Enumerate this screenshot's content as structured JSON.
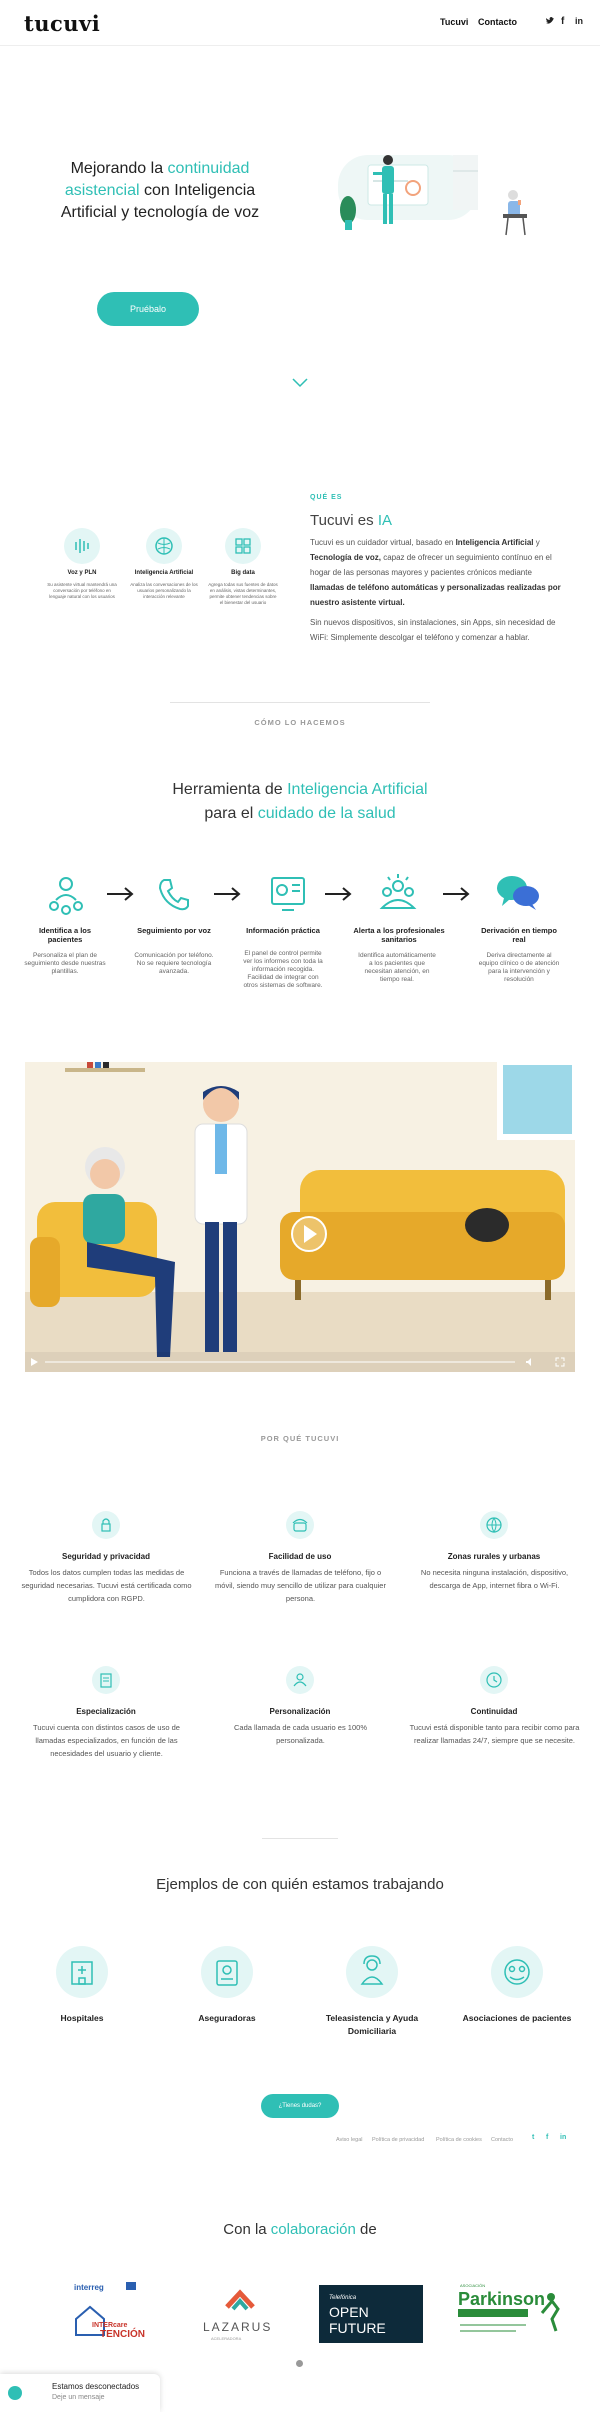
{
  "header": {
    "logo": "tucuvi",
    "nav": [
      "Tucuvi",
      "Contacto"
    ],
    "social": [
      "twitter-icon",
      "facebook-icon",
      "linkedin-icon"
    ]
  },
  "hero": {
    "title_before": "Mejorando la ",
    "title_highlight": "continuidad asistencial",
    "title_after": " con Inteligencia Artificial y tecnología de voz",
    "button": "Pruébalo",
    "accent": "#2fbfb5"
  },
  "que_es": {
    "label": "QUÉ ES",
    "title_before": "Tucuvi es ",
    "title_highlight": "IA",
    "p1_a": "Tucuvi es un cuidador virtual, basado en ",
    "p1_b": "Inteligencia Artificial",
    "p1_c": " y ",
    "p1_d": "Tecnología de voz,",
    "p1_e": " capaz de ofrecer un seguimiento contínuo en el hogar de las personas mayores y pacientes crónicos mediante ",
    "p1_f": "llamadas de teléfono automáticas y personalizadas realizadas por nuestro asistente virtual.",
    "p2": "Sin nuevos dispositivos, sin instalaciones, sin Apps, sin necesidad de WiFi: Simplemente descolgar el teléfono y comenzar a hablar.",
    "features": [
      {
        "title": "Voz y PLN",
        "text": "Su asistente virtual mantendrá una conversación por teléfono en lenguaje natural con los usuarios"
      },
      {
        "title": "Inteligencia Artificial",
        "text": "Analiza las conversaciones de los usuarios personalizando la interacción relevante"
      },
      {
        "title": "Big data",
        "text": "Agrega todas sus fuentes de datos en análisis, vistas determinantes, permite obtener tendencias sobre el bienestar del usuario"
      }
    ]
  },
  "como": {
    "label": "CÓMO LO HACEMOS",
    "h1_a": "Herramienta de ",
    "h1_b": "Inteligencia Artificial",
    "h2_a": "para el ",
    "h2_b": "cuidado de la salud",
    "steps": [
      {
        "title": "Identifica a los pacientes",
        "text": "Personaliza el plan de seguimiento desde nuestras plantillas."
      },
      {
        "title": "Seguimiento por voz",
        "text": "Comunicación por teléfono. No se requiere tecnología avanzada."
      },
      {
        "title": "Información práctica",
        "text": "El panel de control permite ver los informes con toda la información recogida. Facilidad de integrar con otros sistemas de software."
      },
      {
        "title": "Alerta a los profesionales sanitarios",
        "text": "Identifica automáticamente a los pacientes que necesitan atención, en tiempo real."
      },
      {
        "title": "Derivación en tiempo real",
        "text": "Deriva directamente al equipo clínico o de atención para la intervención y resolución"
      }
    ]
  },
  "video": {
    "progress": 0.0
  },
  "por_que": {
    "label": "POR QUÉ TUCUVI",
    "items": [
      {
        "title": "Seguridad y privacidad",
        "text": "Todos los datos cumplen todas las medidas de seguridad necesarias. Tucuvi está certificada como cumplidora con RGPD."
      },
      {
        "title": "Facilidad de uso",
        "text": "Funciona a través de llamadas de teléfono, fijo o móvil, siendo muy sencillo de utilizar para cualquier persona."
      },
      {
        "title": "Zonas rurales y urbanas",
        "text": "No necesita ninguna instalación, dispositivo, descarga de App, internet fibra o Wi-Fi."
      },
      {
        "title": "Especialización",
        "text": "Tucuvi cuenta con distintos casos de uso de llamadas especializados, en función de las necesidades del usuario y cliente."
      },
      {
        "title": "Personalización",
        "text": "Cada llamada de cada usuario es 100% personalizada."
      },
      {
        "title": "Continuidad",
        "text": "Tucuvi está disponible tanto para recibir como para realizar llamadas 24/7, siempre que se necesite."
      }
    ]
  },
  "ejemplos": {
    "title": "Ejemplos de con quién estamos trabajando",
    "items": [
      "Hospitales",
      "Aseguradoras",
      "Teleasistencia y Ayuda Domiciliaria",
      "Asociaciones de pacientes"
    ],
    "button": "¿Tienes dudas?"
  },
  "footer_links": [
    "Aviso legal",
    "Política de privacidad",
    "Política de cookies",
    "Contacto"
  ],
  "colab": {
    "title_a": "Con la ",
    "title_b": "colaboración",
    "title_c": " de",
    "logos": [
      {
        "name": "INTERREG",
        "text": "Interreg Sudoe",
        "sub": "INTERcare TENCIÓN"
      },
      {
        "name": "LAZARUS",
        "text": "LAZARUS",
        "sub": "ACELERADORA"
      },
      {
        "name": "OPEN FUTURE",
        "text": "OPEN FUTURE",
        "sub": "Telefónica"
      },
      {
        "name": "Parkinson",
        "text": "Parkinson",
        "sub": "Asociación"
      }
    ]
  },
  "chat": {
    "status": "Estamos desconectados",
    "sub": "Deje un mensaje"
  }
}
